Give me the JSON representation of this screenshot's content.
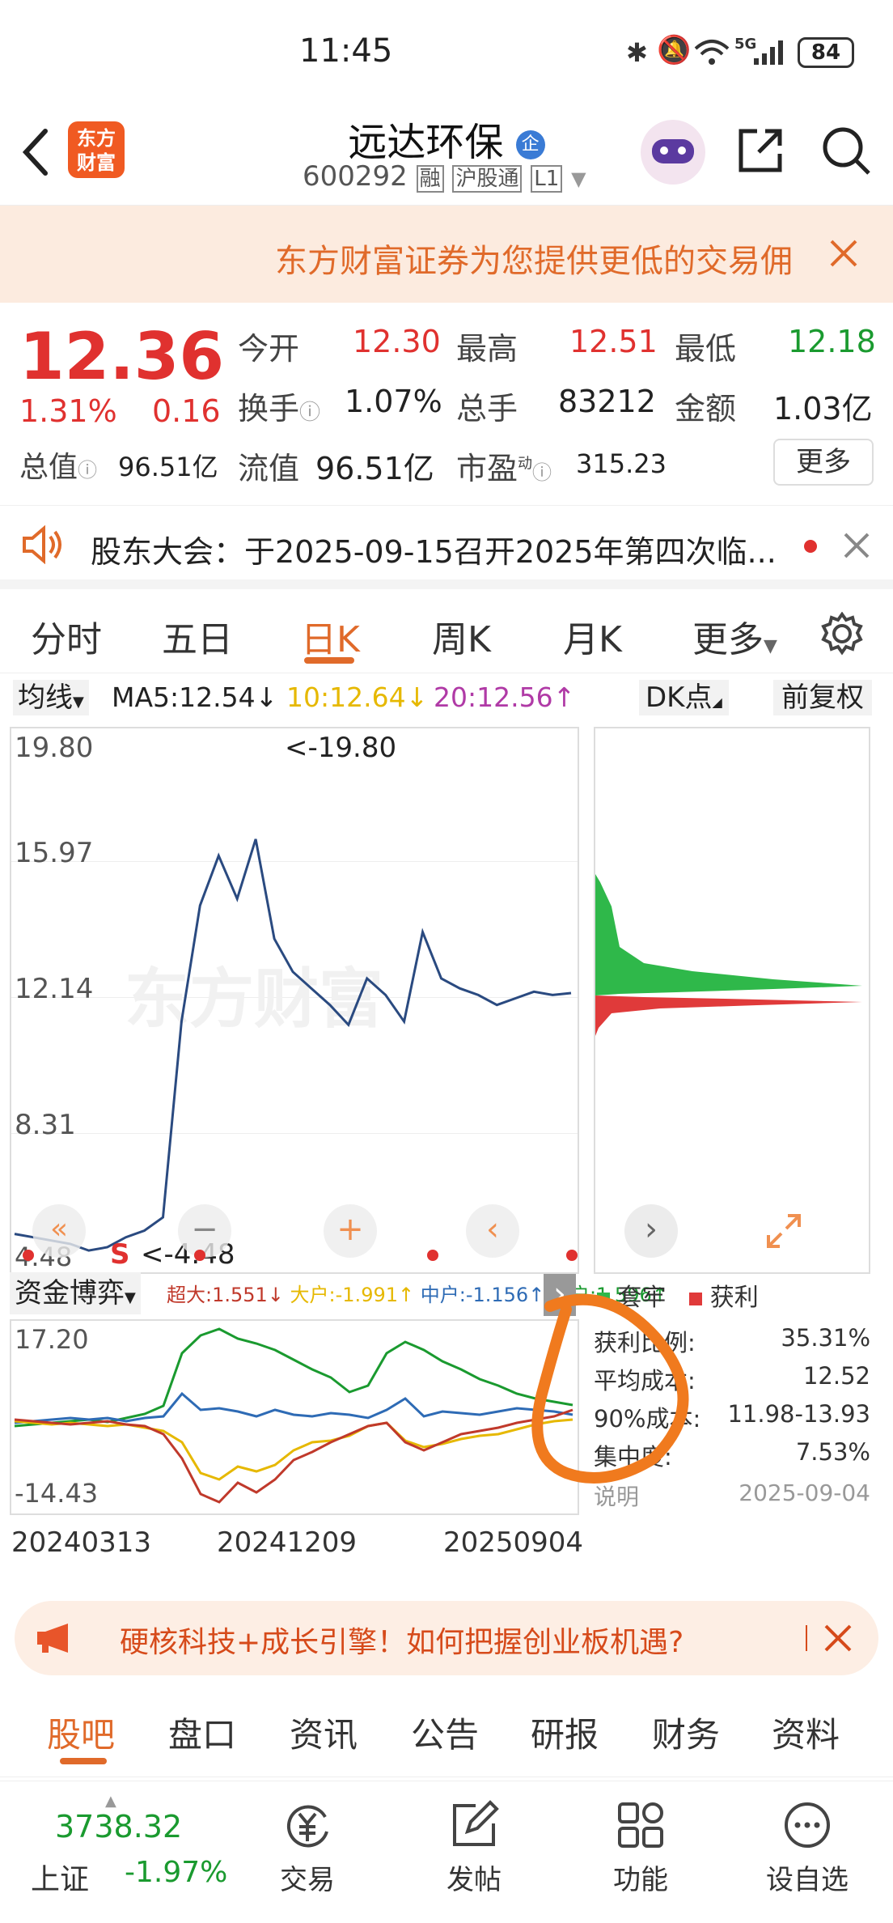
{
  "status": {
    "time": "11:45",
    "battery": "84",
    "net": "5G"
  },
  "header": {
    "name": "远达环保",
    "name_badge": "企",
    "code": "600292",
    "tags": [
      "融",
      "沪股通",
      "L1"
    ],
    "logo_line1": "东方",
    "logo_line2": "财富"
  },
  "promo": {
    "text": "东方财富证券为您提供更低的交易佣"
  },
  "quote": {
    "price": "12.36",
    "change_pct": "1.31%",
    "change": "0.16",
    "row1": [
      {
        "label": "今开",
        "value": "12.30",
        "color": "red"
      },
      {
        "label": "最高",
        "value": "12.51",
        "color": "red"
      },
      {
        "label": "最低",
        "value": "12.18",
        "color": "green"
      }
    ],
    "row2": [
      {
        "label": "换手",
        "value": "1.07%"
      },
      {
        "label": "总手",
        "value": "83212"
      },
      {
        "label": "金额",
        "value": "1.03亿"
      }
    ],
    "total_mv_label": "总值",
    "total_mv": "96.51亿",
    "float_mv_label": "流值",
    "float_mv": "96.51亿",
    "pe_label": "市盈",
    "pe_sup": "动",
    "pe": "315.23",
    "more": "更多"
  },
  "notice": {
    "text": "股东大会：于2025-09-15召开2025年第四次临..."
  },
  "ktabs": {
    "items": [
      "分时",
      "五日",
      "日K",
      "周K",
      "月K",
      "更多"
    ],
    "active": 2
  },
  "ma": {
    "selector": "均线",
    "ma5": "MA5:12.54↓",
    "ma10": "10:12.64↓",
    "ma20": "20:12.56↑",
    "dk": "DK点",
    "adjust": "前复权"
  },
  "chart": {
    "y_max": "19.80",
    "y2": "15.97",
    "y3": "12.14",
    "y4": "8.31",
    "y_min": "4.48",
    "high_note": "<-19.80",
    "low_note": "<-4.48",
    "s_mark": "S",
    "watermark": "东方财富",
    "fund_selector": "资金博弈",
    "fund_legend": [
      {
        "text": "超大:1.551↓",
        "color": "#c0392b"
      },
      {
        "text": "大户:-1.991↑",
        "color": "#e6b800"
      },
      {
        "text": "中户:-1.156↑",
        "color": "#2e6bb5"
      },
      {
        "text": "小户:1.596↑",
        "color": "#1a9a2f"
      }
    ],
    "fund_max": "17.20",
    "fund_min": "-14.43",
    "dates": [
      "20240313",
      "20241209",
      "20250904"
    ]
  },
  "chart_data": {
    "type": "line",
    "title": "",
    "ylim": [
      4.48,
      19.8
    ],
    "x_labels": [
      "20240313",
      "20241209",
      "20250904"
    ],
    "series": [
      {
        "name": "",
        "values": [
          5.1,
          5.0,
          4.9,
          4.8,
          4.6,
          4.7,
          5.0,
          5.2,
          5.6,
          11.5,
          15.0,
          16.5,
          15.2,
          17.0,
          14.0,
          13.0,
          12.5,
          12.0,
          11.4,
          12.8,
          12.3,
          11.5,
          14.2,
          12.8,
          12.5,
          12.3,
          12.0,
          12.2,
          12.4,
          12.3,
          12.36
        ]
      }
    ]
  },
  "cost": {
    "legend_loss": "套牢",
    "legend_profit": "获利",
    "rows": [
      {
        "label": "获利比例:",
        "value": "35.31%"
      },
      {
        "label": "平均成本:",
        "value": "12.52"
      },
      {
        "label": "90%成本:",
        "value": "11.98-13.93"
      },
      {
        "label": "集中度:",
        "value": "7.53%"
      }
    ],
    "explain": "说明",
    "date": "2025-09-04",
    "loss_color": "#2fb84a",
    "profit_color": "#e03a3a"
  },
  "ad": {
    "text": "硬核科技+成长引擎！如何把握创业板机遇?"
  },
  "bottomtabs": {
    "items": [
      "股吧",
      "盘口",
      "资讯",
      "公告",
      "研报",
      "财务",
      "资料"
    ],
    "active": 0
  },
  "dock": {
    "index_value": "3738.32",
    "index_name": "上证",
    "index_change": "-1.97%",
    "items": [
      "交易",
      "发帖",
      "功能",
      "设自选"
    ]
  }
}
